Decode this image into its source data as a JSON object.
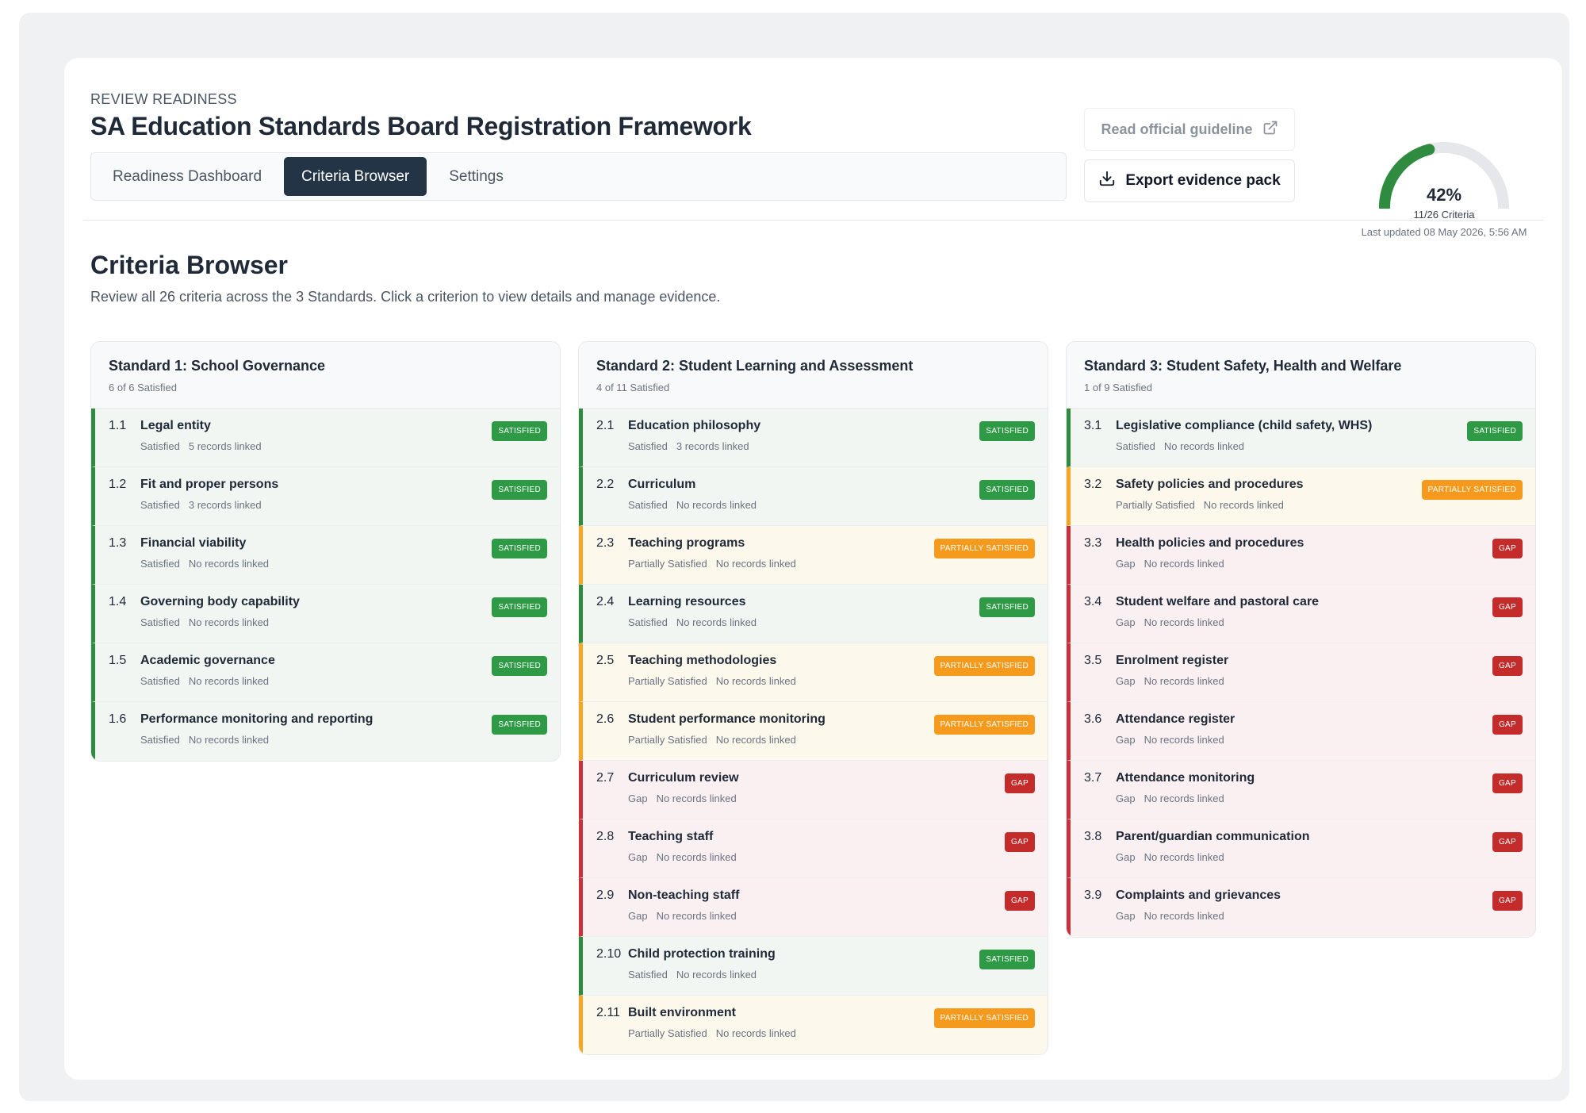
{
  "header": {
    "eyebrow": "REVIEW READINESS",
    "title": "SA Education Standards Board Registration Framework",
    "tabs": [
      {
        "label": "Readiness Dashboard",
        "active": false
      },
      {
        "label": "Criteria Browser",
        "active": true
      },
      {
        "label": "Settings",
        "active": false
      }
    ],
    "guide_button": "Read official guideline",
    "export_button": "Export evidence pack",
    "gauge": {
      "percent_label": "42%",
      "percent": 0.42,
      "criteria_label": "11/26 Criteria",
      "updated_label": "Last updated 08 May 2026, 5:56 AM"
    }
  },
  "colors": {
    "satisfied": "#2e9a46",
    "partial": "#f59a1c",
    "gap": "#c42b2b",
    "active_tab": "#243447"
  },
  "main": {
    "title": "Criteria Browser",
    "description": "Review all 26 criteria across the 3 Standards. Click a criterion to view details and manage evidence."
  },
  "standards": [
    {
      "title": "Standard 1: School Governance",
      "summary": "6 of 6 Satisfied",
      "criteria": [
        {
          "num": "1.1",
          "name": "Legal entity",
          "status": "Satisfied",
          "records": "5 records linked",
          "badge": "SATISFIED",
          "kind": "sat"
        },
        {
          "num": "1.2",
          "name": "Fit and proper persons",
          "status": "Satisfied",
          "records": "3 records linked",
          "badge": "SATISFIED",
          "kind": "sat"
        },
        {
          "num": "1.3",
          "name": "Financial viability",
          "status": "Satisfied",
          "records": "No records linked",
          "badge": "SATISFIED",
          "kind": "sat"
        },
        {
          "num": "1.4",
          "name": "Governing body capability",
          "status": "Satisfied",
          "records": "No records linked",
          "badge": "SATISFIED",
          "kind": "sat"
        },
        {
          "num": "1.5",
          "name": "Academic governance",
          "status": "Satisfied",
          "records": "No records linked",
          "badge": "SATISFIED",
          "kind": "sat"
        },
        {
          "num": "1.6",
          "name": "Performance monitoring and reporting",
          "status": "Satisfied",
          "records": "No records linked",
          "badge": "SATISFIED",
          "kind": "sat"
        }
      ]
    },
    {
      "title": "Standard 2: Student Learning and Assessment",
      "summary": "4 of 11 Satisfied",
      "criteria": [
        {
          "num": "2.1",
          "name": "Education philosophy",
          "status": "Satisfied",
          "records": "3 records linked",
          "badge": "SATISFIED",
          "kind": "sat"
        },
        {
          "num": "2.2",
          "name": "Curriculum",
          "status": "Satisfied",
          "records": "No records linked",
          "badge": "SATISFIED",
          "kind": "sat"
        },
        {
          "num": "2.3",
          "name": "Teaching programs",
          "status": "Partially Satisfied",
          "records": "No records linked",
          "badge": "PARTIALLY SATISFIED",
          "kind": "part"
        },
        {
          "num": "2.4",
          "name": "Learning resources",
          "status": "Satisfied",
          "records": "No records linked",
          "badge": "SATISFIED",
          "kind": "sat"
        },
        {
          "num": "2.5",
          "name": "Teaching methodologies",
          "status": "Partially Satisfied",
          "records": "No records linked",
          "badge": "PARTIALLY SATISFIED",
          "kind": "part"
        },
        {
          "num": "2.6",
          "name": "Student performance monitoring",
          "status": "Partially Satisfied",
          "records": "No records linked",
          "badge": "PARTIALLY SATISFIED",
          "kind": "part"
        },
        {
          "num": "2.7",
          "name": "Curriculum review",
          "status": "Gap",
          "records": "No records linked",
          "badge": "GAP",
          "kind": "gap"
        },
        {
          "num": "2.8",
          "name": "Teaching staff",
          "status": "Gap",
          "records": "No records linked",
          "badge": "GAP",
          "kind": "gap"
        },
        {
          "num": "2.9",
          "name": "Non-teaching staff",
          "status": "Gap",
          "records": "No records linked",
          "badge": "GAP",
          "kind": "gap"
        },
        {
          "num": "2.10",
          "name": "Child protection training",
          "status": "Satisfied",
          "records": "No records linked",
          "badge": "SATISFIED",
          "kind": "sat"
        },
        {
          "num": "2.11",
          "name": "Built environment",
          "status": "Partially Satisfied",
          "records": "No records linked",
          "badge": "PARTIALLY SATISFIED",
          "kind": "part"
        }
      ]
    },
    {
      "title": "Standard 3: Student Safety, Health and Welfare",
      "summary": "1 of 9 Satisfied",
      "criteria": [
        {
          "num": "3.1",
          "name": "Legislative compliance (child safety, WHS)",
          "status": "Satisfied",
          "records": "No records linked",
          "badge": "SATISFIED",
          "kind": "sat"
        },
        {
          "num": "3.2",
          "name": "Safety policies and procedures",
          "status": "Partially Satisfied",
          "records": "No records linked",
          "badge": "PARTIALLY SATISFIED",
          "kind": "part"
        },
        {
          "num": "3.3",
          "name": "Health policies and procedures",
          "status": "Gap",
          "records": "No records linked",
          "badge": "GAP",
          "kind": "gap"
        },
        {
          "num": "3.4",
          "name": "Student welfare and pastoral care",
          "status": "Gap",
          "records": "No records linked",
          "badge": "GAP",
          "kind": "gap"
        },
        {
          "num": "3.5",
          "name": "Enrolment register",
          "status": "Gap",
          "records": "No records linked",
          "badge": "GAP",
          "kind": "gap"
        },
        {
          "num": "3.6",
          "name": "Attendance register",
          "status": "Gap",
          "records": "No records linked",
          "badge": "GAP",
          "kind": "gap"
        },
        {
          "num": "3.7",
          "name": "Attendance monitoring",
          "status": "Gap",
          "records": "No records linked",
          "badge": "GAP",
          "kind": "gap"
        },
        {
          "num": "3.8",
          "name": "Parent/guardian communication",
          "status": "Gap",
          "records": "No records linked",
          "badge": "GAP",
          "kind": "gap"
        },
        {
          "num": "3.9",
          "name": "Complaints and grievances",
          "status": "Gap",
          "records": "No records linked",
          "badge": "GAP",
          "kind": "gap"
        }
      ]
    }
  ]
}
